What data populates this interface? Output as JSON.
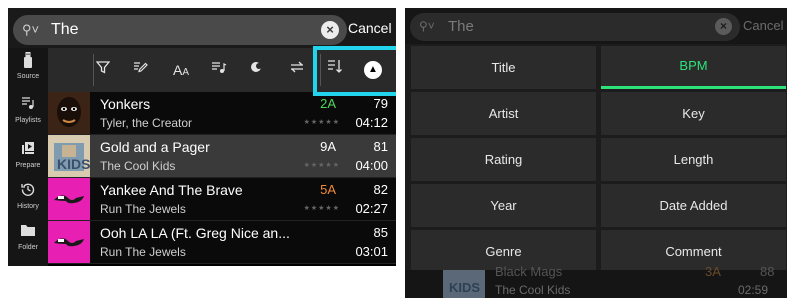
{
  "left": {
    "search": {
      "value": "The",
      "cancel_label": "Cancel"
    },
    "toolbar": {
      "icons": [
        "filter-icon",
        "edit-icon",
        "text-size-icon",
        "playlist-add-icon",
        "toggle-icon",
        "swap-icon",
        "sort-icon",
        "up-arrow-icon"
      ]
    },
    "sidebar": [
      {
        "label": "Source",
        "icon": "usb-icon"
      },
      {
        "label": "Playlists",
        "icon": "playlist-icon"
      },
      {
        "label": "Prepare",
        "icon": "prepare-icon"
      },
      {
        "label": "History",
        "icon": "history-icon"
      },
      {
        "label": "Folder",
        "icon": "folder-icon"
      }
    ],
    "tracks": [
      {
        "title": "Yonkers",
        "artist": "Tyler, the Creator",
        "key": "2A",
        "key_color": "#4fd65a",
        "bpm": "79",
        "length": "04:12",
        "rating": 0,
        "art_color": "#2c1a12"
      },
      {
        "title": "Gold and a Pager",
        "artist": "The Cool Kids",
        "key": "9A",
        "key_color": "#ffffff",
        "bpm": "81",
        "length": "04:00",
        "rating": 0,
        "art_color": "#d8c7a8"
      },
      {
        "title": "Yankee And The Brave",
        "artist": "Run The Jewels",
        "key": "5A",
        "key_color": "#f08a3a",
        "bpm": "82",
        "length": "02:27",
        "rating": 0,
        "art_color": "#e81fb3"
      },
      {
        "title": "Ooh LA LA (Ft. Greg Nice an...",
        "artist": "Run The Jewels",
        "key": "",
        "key_color": "#ffffff",
        "bpm": "85",
        "length": "03:01",
        "rating": 0,
        "art_color": "#e81fb3"
      }
    ]
  },
  "right": {
    "search": {
      "value": "The",
      "cancel_label": "Cancel"
    },
    "sort_options": [
      {
        "label": "Title",
        "active": false
      },
      {
        "label": "BPM",
        "active": true
      },
      {
        "label": "Artist",
        "active": false
      },
      {
        "label": "Key",
        "active": false
      },
      {
        "label": "Rating",
        "active": false
      },
      {
        "label": "Length",
        "active": false
      },
      {
        "label": "Year",
        "active": false
      },
      {
        "label": "Date Added",
        "active": false
      },
      {
        "label": "Genre",
        "active": false
      },
      {
        "label": "Comment",
        "active": false
      }
    ],
    "background_track": {
      "title": "Black Mags",
      "artist": "The Cool Kids",
      "key": "3A",
      "bpm": "88",
      "length": "02:59"
    }
  },
  "colors": {
    "accent_green": "#2ee27a",
    "highlight_cyan": "#22d4ec"
  }
}
